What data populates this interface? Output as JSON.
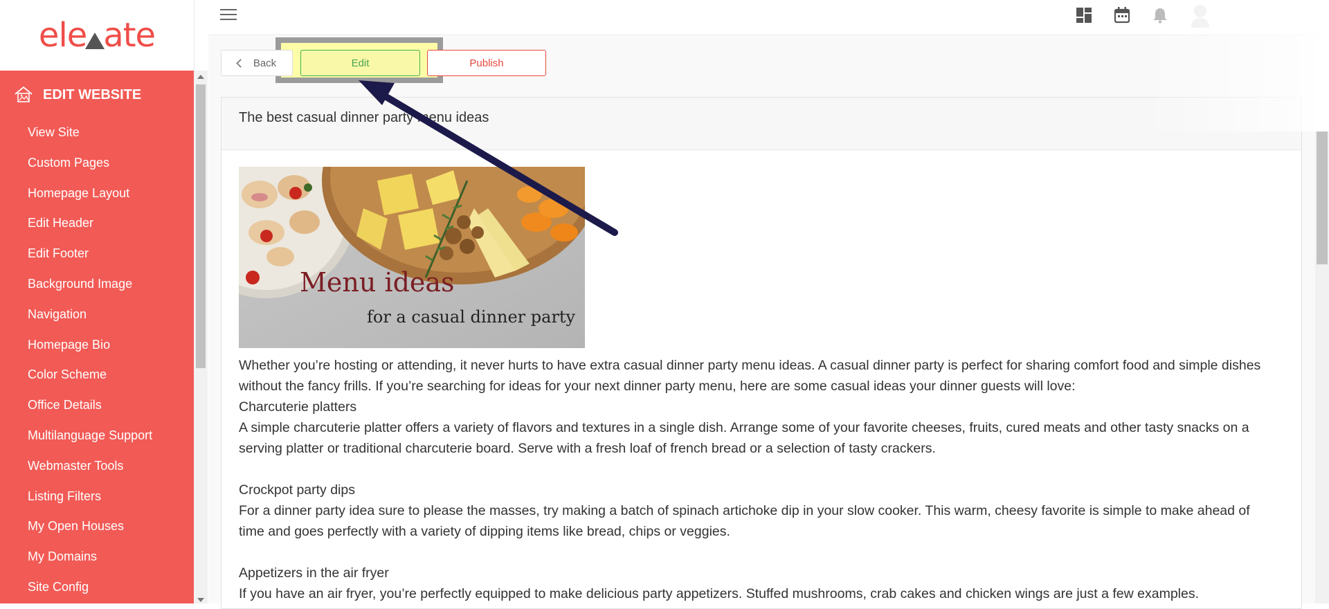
{
  "app": {
    "logo_text_left": "ele",
    "logo_text_right": "ate"
  },
  "sidebar": {
    "heading": "EDIT WEBSITE",
    "items": [
      {
        "label": "View Site"
      },
      {
        "label": "Custom Pages"
      },
      {
        "label": "Homepage Layout"
      },
      {
        "label": "Edit Header"
      },
      {
        "label": "Edit Footer"
      },
      {
        "label": "Background Image"
      },
      {
        "label": "Navigation"
      },
      {
        "label": "Homepage Bio"
      },
      {
        "label": "Color Scheme"
      },
      {
        "label": "Office Details"
      },
      {
        "label": "Multilanguage Support"
      },
      {
        "label": "Webmaster Tools"
      },
      {
        "label": "Listing Filters"
      },
      {
        "label": "My Open Houses"
      },
      {
        "label": "My Domains"
      },
      {
        "label": "Site Config"
      }
    ]
  },
  "topbar": {
    "icons": [
      "menu-icon",
      "dashboard-icon",
      "calendar-icon",
      "bell-icon",
      "user-avatar-icon"
    ]
  },
  "toolbar": {
    "back_label": "Back",
    "edit_label": "Edit",
    "publish_label": "Publish"
  },
  "post": {
    "title": "The best casual dinner party menu ideas",
    "image": {
      "line1": "Menu ideas",
      "line2": "for a casual dinner party"
    },
    "paragraphs": [
      "Whether you’re hosting or attending, it never hurts to have extra casual dinner party menu ideas. A casual dinner party is perfect for sharing comfort food and simple dishes without the fancy frills. If you’re searching for ideas for your next dinner party menu, here are some casual ideas your dinner guests will love:",
      "Charcuterie platters",
      "A simple charcuterie platter offers a variety of flavors and textures in a single dish. Arrange some of your favorite cheeses, fruits, cured meats and other tasty snacks on a serving platter or traditional charcuterie board. Serve with a fresh loaf of french bread or a selection of tasty crackers.",
      "Crockpot party dips",
      "For a dinner party idea sure to please the masses, try making a batch of spinach artichoke dip in your slow cooker. This warm, cheesy favorite is simple to make ahead of time and goes perfectly with a variety of dipping items like bread, chips or veggies.",
      "Appetizers in the air fryer",
      "If you have an air fryer, you’re perfectly equipped to make delicious party appetizers. Stuffed mushrooms, crab cakes and chicken wings are just a few examples."
    ]
  },
  "colors": {
    "sidebar_bg": "#f25a55",
    "brand": "#ef4d48",
    "edit_green": "#43b04a",
    "publish_red": "#e8473f",
    "highlight_yellow": "#fdfda8",
    "arrow_navy": "#1c1a4a"
  }
}
